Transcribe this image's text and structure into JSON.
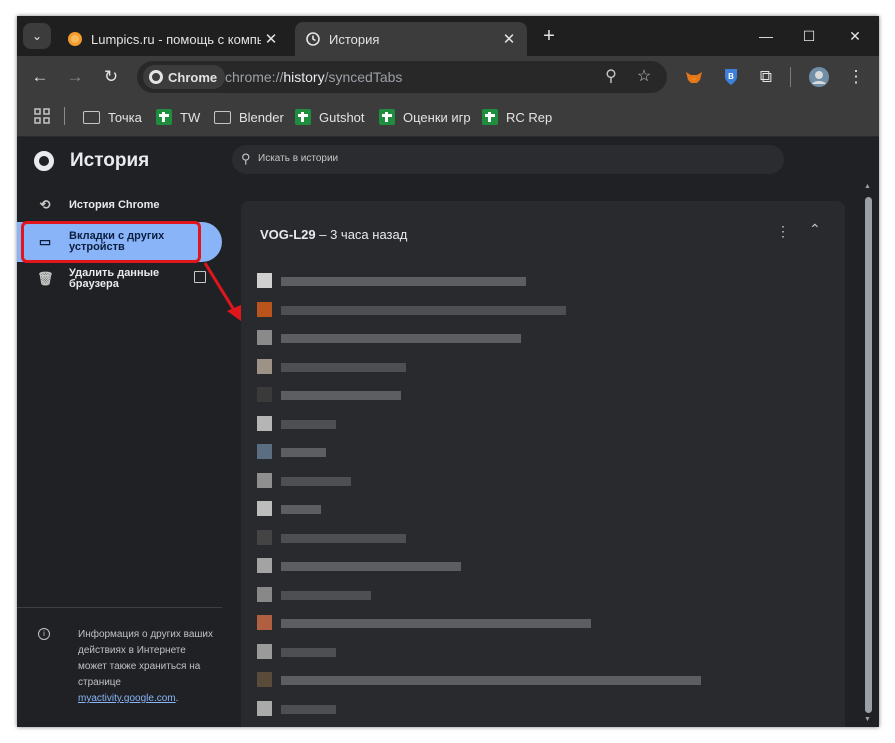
{
  "tabs": [
    {
      "title": "Lumpics.ru - помощь с компь",
      "active": false
    },
    {
      "title": "История",
      "active": true
    }
  ],
  "omnibox": {
    "chip_label": "Chrome",
    "url_scheme": "chrome://",
    "url_host": "history",
    "url_path": "/syncedTabs"
  },
  "bookmarks": [
    "Точка",
    "TW",
    "Blender",
    "Gutshot",
    "Оценки игр",
    "RC Rep"
  ],
  "page": {
    "title": "История",
    "search_placeholder": "Искать в истории"
  },
  "sidebar": {
    "items": [
      {
        "label": "История Chrome",
        "icon": "history-icon",
        "selected": false
      },
      {
        "label": "Вкладки с других устройств",
        "icon": "devices-icon",
        "selected": true
      },
      {
        "label": "Удалить данные браузера",
        "icon": "trash-icon",
        "selected": false
      }
    ],
    "info_text": "Информация о других ваших действиях в Интернете может также храниться на странице",
    "info_link": "myactivity.google.com",
    "info_suffix": "."
  },
  "device_card": {
    "device": "VOG-L29",
    "time": " – 3 часа назад"
  },
  "colors": {
    "accent": "#8ab4f8",
    "highlight": "#e0161c",
    "background": "#202124",
    "card": "#292a2d"
  }
}
